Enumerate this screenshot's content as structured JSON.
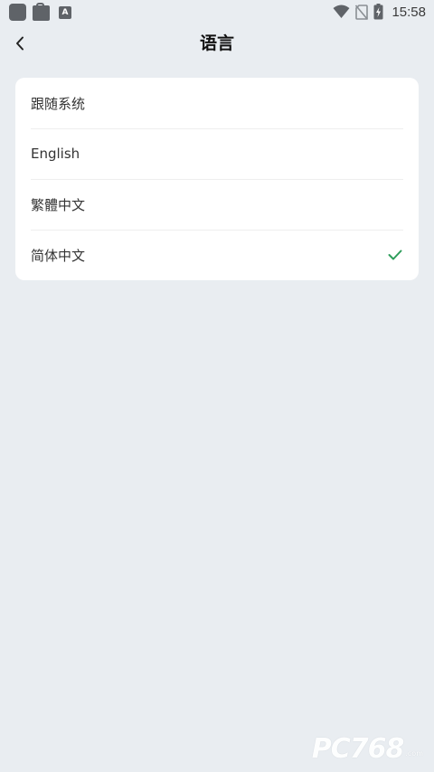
{
  "status_bar": {
    "time": "15:58",
    "notification_icons": [
      "app-icon",
      "shopping-bag-icon",
      "a-icon"
    ],
    "a_icon_letter": "A",
    "system_icons": [
      "wifi-icon",
      "no-sim-icon",
      "battery-charging-icon"
    ]
  },
  "header": {
    "back_icon": "chevron-left-icon",
    "title": "语言"
  },
  "language_list": {
    "options": [
      {
        "label": "跟随系统",
        "selected": false
      },
      {
        "label": "English",
        "selected": false
      },
      {
        "label": "繁體中文",
        "selected": false
      },
      {
        "label": "简体中文",
        "selected": true
      }
    ],
    "check_icon": "check-icon"
  },
  "watermark": {
    "text": "PC768",
    "sub": ".com"
  },
  "colors": {
    "background": "#e9edf1",
    "card": "#ffffff",
    "accent_check": "#2e9d5b",
    "title_text": "#111111",
    "item_text": "#333333"
  }
}
